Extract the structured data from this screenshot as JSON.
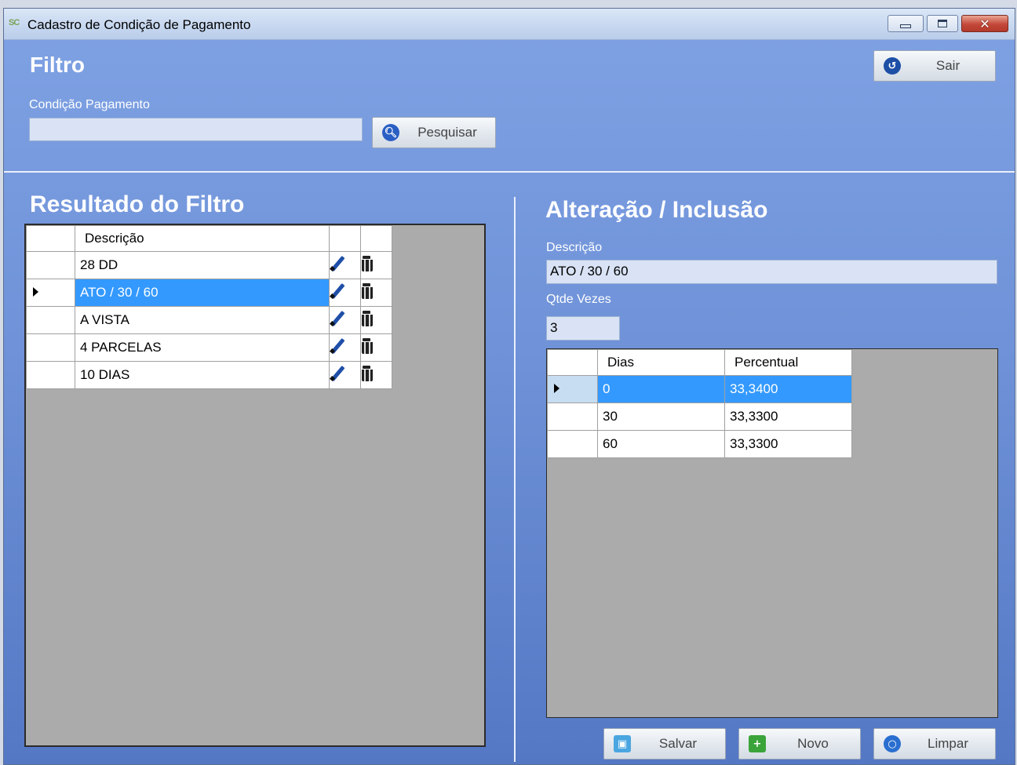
{
  "window": {
    "title": "Cadastro de Condição de Pagamento",
    "app_icon": "SC"
  },
  "filtro": {
    "title": "Filtro",
    "condicao_label": "Condição Pagamento",
    "condicao_value": "",
    "pesquisar_label": "Pesquisar",
    "sair_label": "Sair"
  },
  "resultado": {
    "title": "Resultado do Filtro",
    "column_header": "Descrição",
    "rows": [
      {
        "descricao": "28 DD"
      },
      {
        "descricao": "ATO / 30 / 60"
      },
      {
        "descricao": "A VISTA"
      },
      {
        "descricao": "4 PARCELAS"
      },
      {
        "descricao": "10 DIAS"
      }
    ],
    "selected_index": 1
  },
  "edicao": {
    "title": "Alteração / Inclusão",
    "descricao_label": "Descrição",
    "descricao_value": "ATO / 30 / 60",
    "qtde_label": "Qtde Vezes",
    "qtde_value": "3",
    "col_dias": "Dias",
    "col_percentual": "Percentual",
    "parcelas": [
      {
        "dias": "0",
        "percentual": "33,3400"
      },
      {
        "dias": "30",
        "percentual": "33,3300"
      },
      {
        "dias": "60",
        "percentual": "33,3300"
      }
    ],
    "selected_index": 0,
    "salvar_label": "Salvar",
    "novo_label": "Novo",
    "limpar_label": "Limpar"
  },
  "colors": {
    "selection": "#3399ff",
    "panel_top": "#7fa2e4",
    "panel_bottom": "#5478c4"
  }
}
